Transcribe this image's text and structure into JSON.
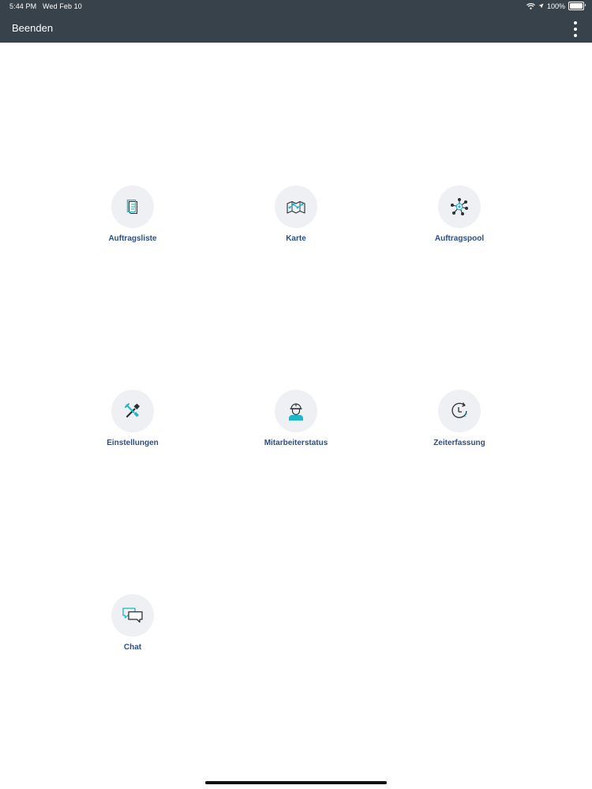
{
  "status_bar": {
    "time": "5:44 PM",
    "date": "Wed Feb 10",
    "battery_text": "100%",
    "battery_level": 1.0
  },
  "nav": {
    "left_label": "Beenden",
    "menu_icon": "more-vertical-icon"
  },
  "colors": {
    "topbar": "#37424b",
    "accent": "#1fb6c8",
    "label": "#2d4f86",
    "tile_bg": "#eef0f3"
  },
  "tiles": [
    {
      "label": "Auftragsliste",
      "icon": "document-list-icon"
    },
    {
      "label": "Karte",
      "icon": "map-icon"
    },
    {
      "label": "Auftragspool",
      "icon": "network-hub-icon"
    },
    {
      "label": "Einstellungen",
      "icon": "tools-icon"
    },
    {
      "label": "Mitarbeiterstatus",
      "icon": "worker-helmet-icon"
    },
    {
      "label": "Zeiterfassung",
      "icon": "clock-icon"
    },
    {
      "label": "Chat",
      "icon": "chat-bubbles-icon"
    }
  ]
}
